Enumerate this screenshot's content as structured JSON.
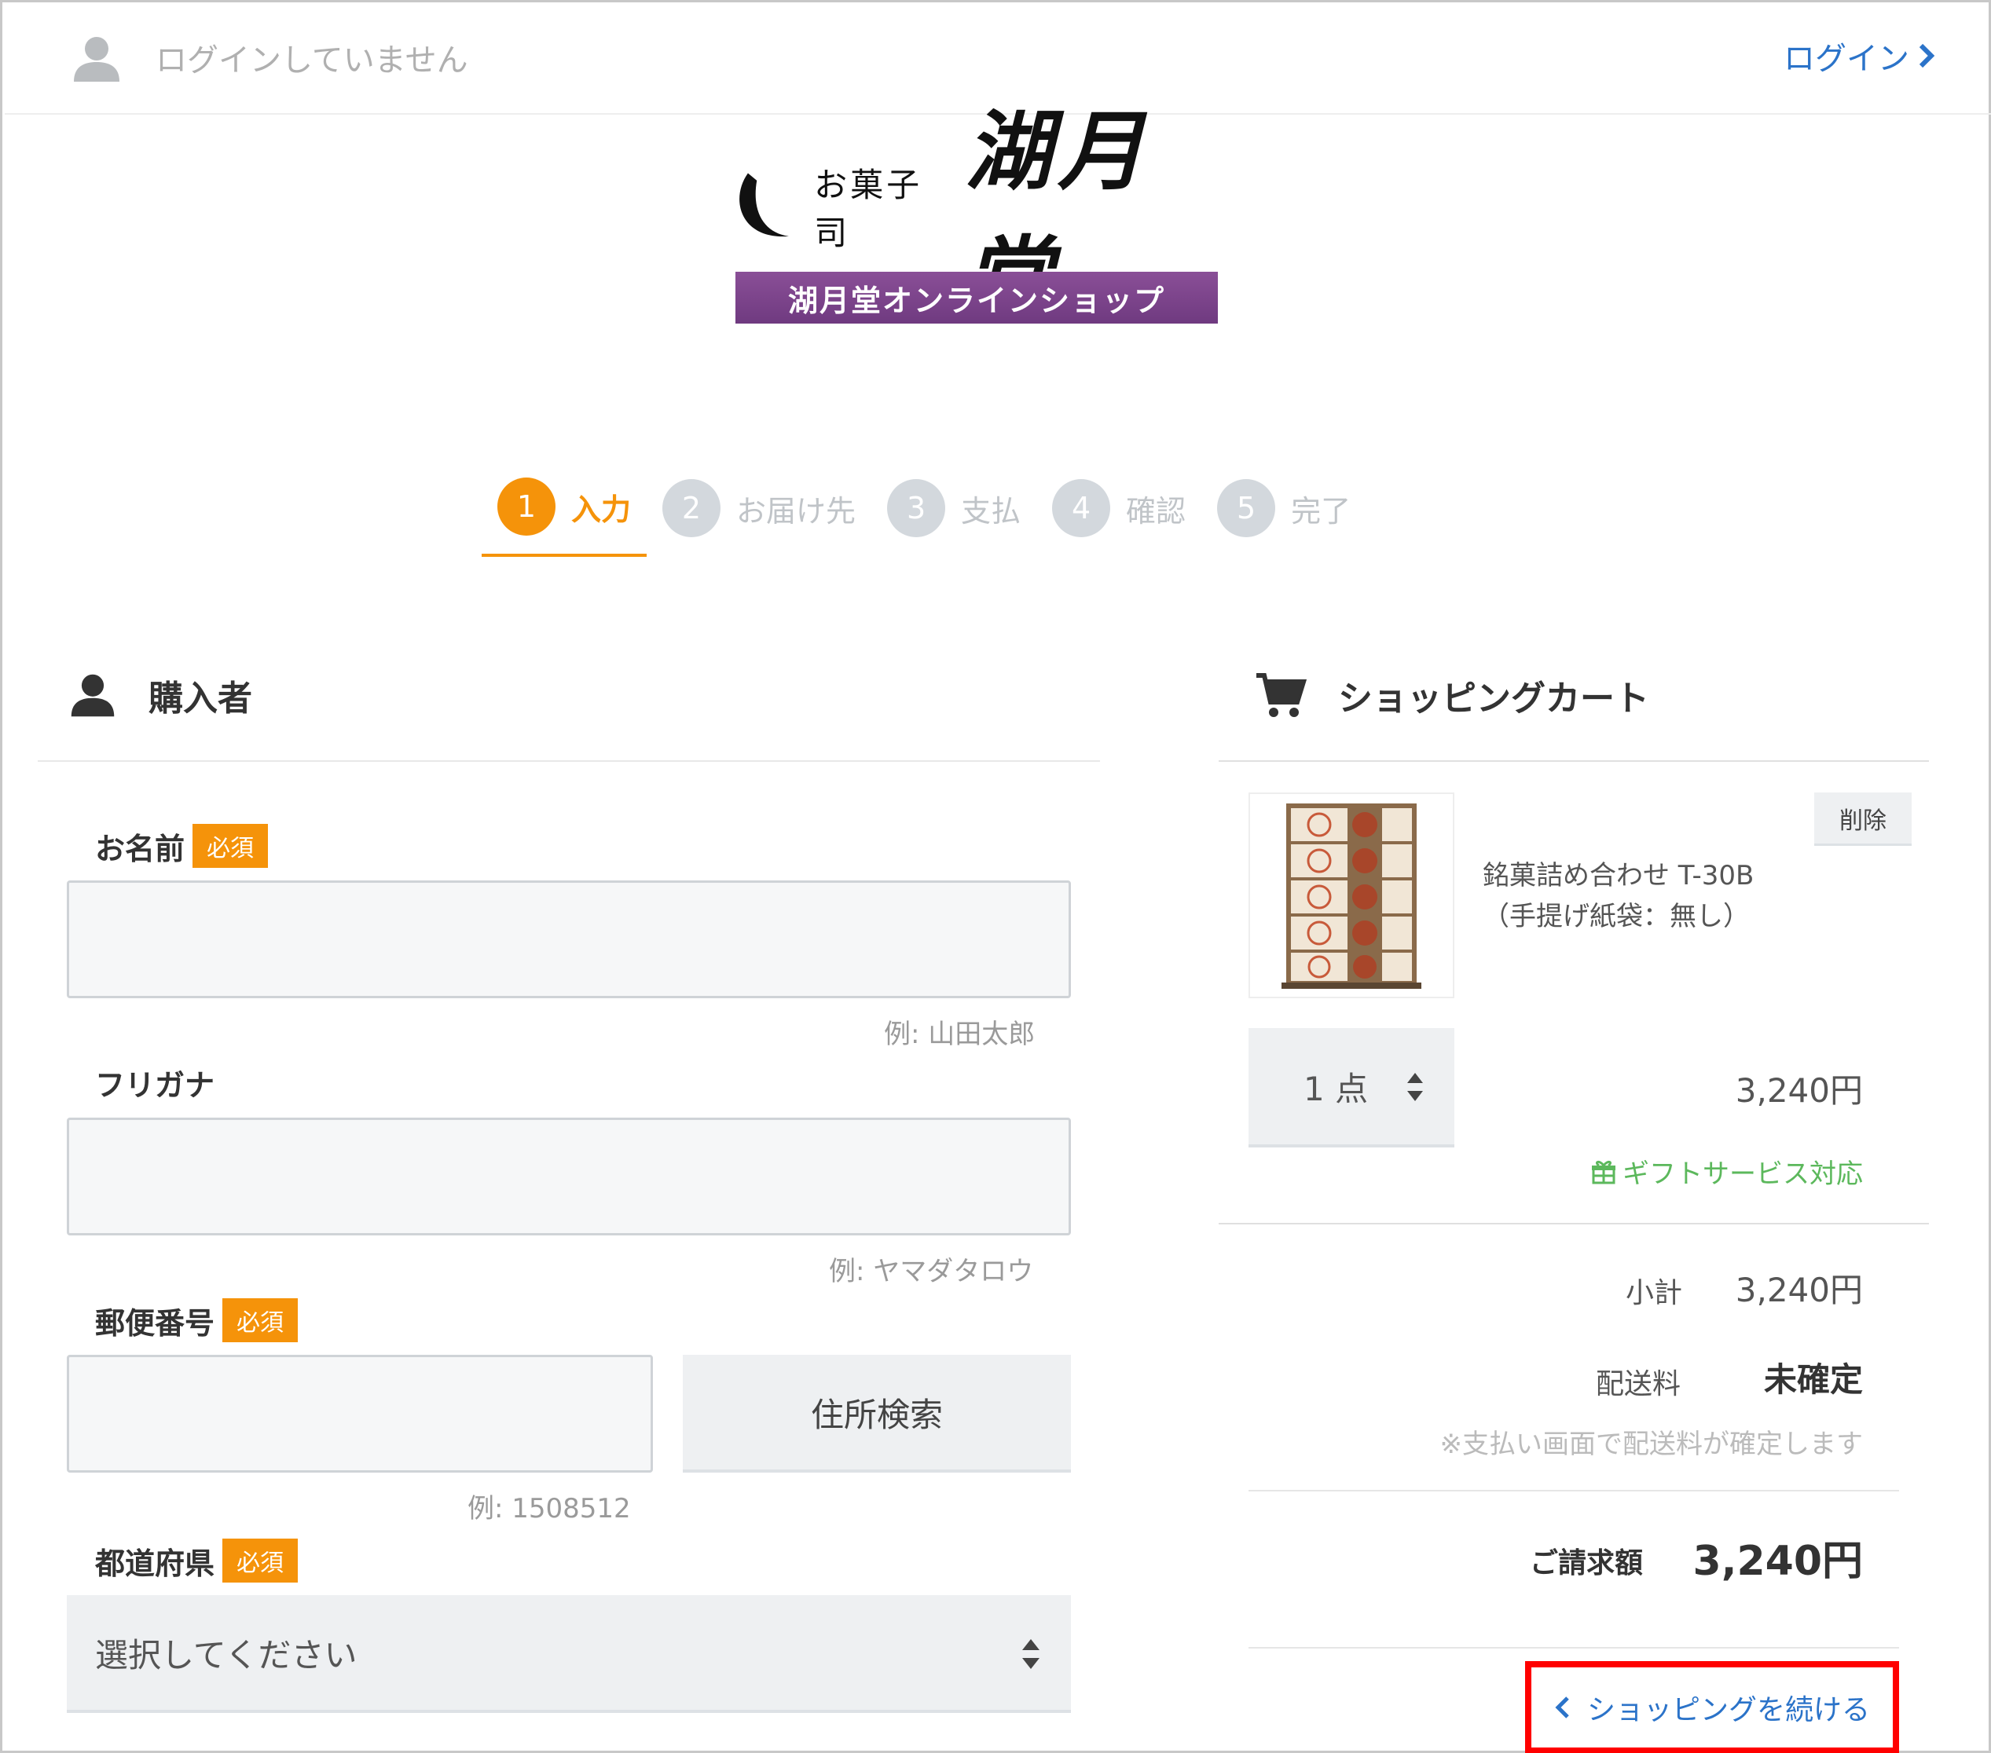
{
  "header": {
    "login_status": "ログインしていません",
    "login_link": "ログイン"
  },
  "logo": {
    "small_text": "お菓子司",
    "big_text": "湖月堂",
    "banner": "湖月堂オンラインショップ"
  },
  "steps": [
    {
      "num": "1",
      "label": "入力",
      "active": true
    },
    {
      "num": "2",
      "label": "お届け先",
      "active": false
    },
    {
      "num": "3",
      "label": "支払",
      "active": false
    },
    {
      "num": "4",
      "label": "確認",
      "active": false
    },
    {
      "num": "5",
      "label": "完了",
      "active": false
    }
  ],
  "buyer": {
    "title": "購入者",
    "required_label": "必須",
    "name_label": "お名前",
    "name_hint": "例: 山田太郎",
    "kana_label": "フリガナ",
    "kana_hint": "例: ヤマダタロウ",
    "zip_label": "郵便番号",
    "zip_hint": "例: 1508512",
    "search_button": "住所検索",
    "pref_label": "都道府県",
    "pref_selected": "選択してください"
  },
  "cart": {
    "title": "ショッピングカート",
    "delete_button": "削除",
    "product_name_line1": "銘菓詰め合わせ T-30B",
    "product_name_line2": "（手提げ紙袋：無し）",
    "quantity": "1 点",
    "price": "3,240円",
    "gift_service": "ギフトサービス対応",
    "subtotal_label": "小計",
    "subtotal_value": "3,240円",
    "shipping_label": "配送料",
    "shipping_value": "未確定",
    "shipping_note": "※支払い画面で配送料が確定します",
    "total_label": "ご請求額",
    "total_value": "3,240円",
    "continue_link": "ショッピングを続ける"
  },
  "colors": {
    "accent": "#f5930a",
    "link": "#2b73c9",
    "gift": "#5cb85c",
    "highlight": "#ff0000",
    "banner": "#7a4389"
  }
}
